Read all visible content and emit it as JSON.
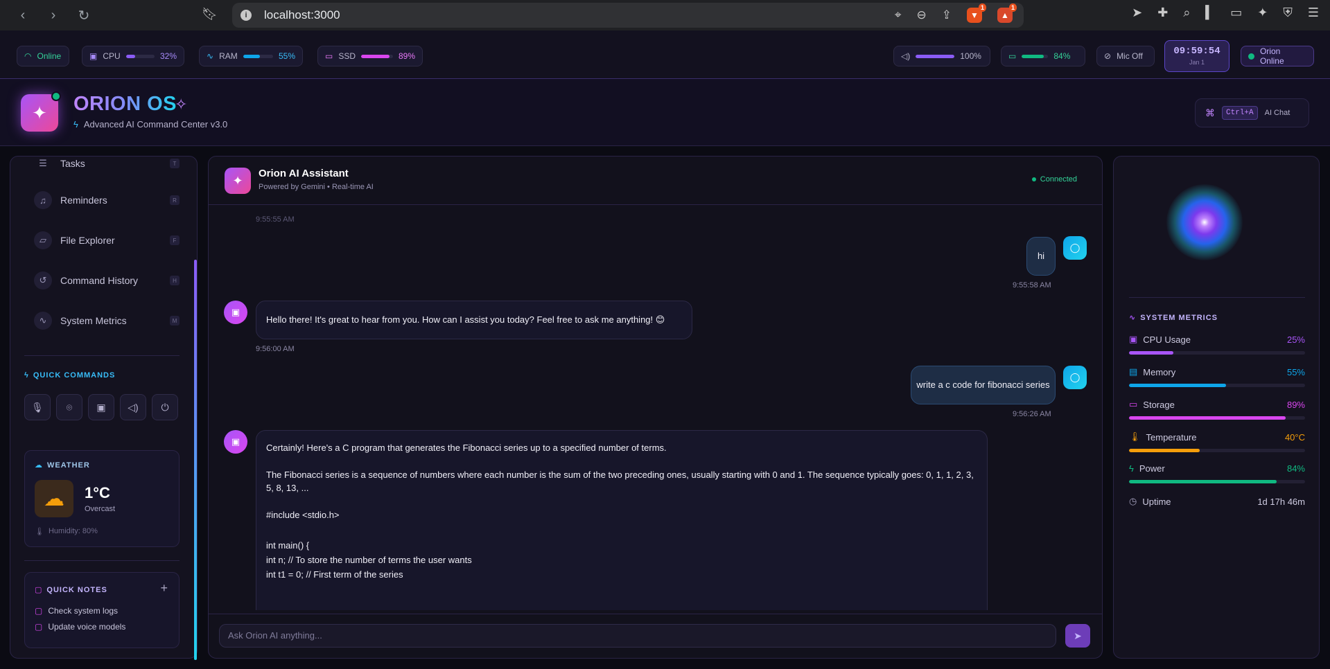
{
  "browser": {
    "url": "localhost:3000",
    "ext_badge_1": "1",
    "ext_badge_2": "1"
  },
  "statusbar": {
    "online": "Online",
    "cpu_label": "CPU",
    "cpu_value": "32%",
    "cpu_level": 0.32,
    "ram_label": "RAM",
    "ram_value": "55%",
    "ram_level": 0.55,
    "ssd_label": "SSD",
    "ssd_value": "89%",
    "ssd_level": 0.89,
    "volume_value": "100%",
    "volume_level": 1.0,
    "battery_value": "84%",
    "battery_level": 0.84,
    "mic": "Mic Off",
    "clock_time": "09:59:54",
    "clock_date": "Jan 1",
    "orion_status": "Orion Online"
  },
  "header": {
    "title": "ORION OS",
    "subtitle": "Advanced AI Command Center v3.0",
    "shortcut_key": "Ctrl+A",
    "shortcut_label": "AI Chat"
  },
  "sidebar": {
    "items": [
      {
        "label": "Tasks",
        "key": "T",
        "icon": "tasks-icon"
      },
      {
        "label": "Reminders",
        "key": "R",
        "icon": "bell-icon"
      },
      {
        "label": "File Explorer",
        "key": "F",
        "icon": "folder-icon"
      },
      {
        "label": "Command History",
        "key": "H",
        "icon": "history-icon"
      },
      {
        "label": "System Metrics",
        "key": "M",
        "icon": "activity-icon"
      }
    ],
    "quick_commands_title": "QUICK COMMANDS",
    "weather": {
      "title": "WEATHER",
      "temp": "1°C",
      "condition": "Overcast",
      "humidity": "Humidity: 80%"
    },
    "notes": {
      "title": "QUICK NOTES",
      "items": [
        "Check system logs",
        "Update voice models"
      ]
    }
  },
  "chat": {
    "title": "Orion AI Assistant",
    "subtitle": "Powered by Gemini • Real-time AI",
    "status": "Connected",
    "partial_time": "9:55:55 AM",
    "messages": [
      {
        "role": "user",
        "text": "hi",
        "time": "9:55:58 AM"
      },
      {
        "role": "bot",
        "text": "Hello there! It's great to hear from you. How can I assist you today? Feel free to ask me anything! 😊",
        "time": "9:56:00 AM"
      },
      {
        "role": "user",
        "text": "write a c code for fibonacci series",
        "time": "9:56:26 AM"
      }
    ],
    "long_reply": {
      "p1": "Certainly! Here's a C program that generates the Fibonacci series up to a specified number of terms.",
      "p2": "The Fibonacci series is a sequence of numbers where each number is the sum of the two preceding ones, usually starting with 0 and 1. The sequence typically goes: 0, 1, 1, 2, 3, 5, 8, 13, ...",
      "code1": "#include <stdio.h>",
      "code2": "int main() {",
      "code3": "int n; // To store the number of terms the user wants",
      "code4": "int t1 = 0; // First term of the series"
    },
    "input_placeholder": "Ask Orion AI anything..."
  },
  "metrics": {
    "title": "SYSTEM METRICS",
    "cpu_label": "CPU Usage",
    "cpu_value": "25%",
    "cpu_level": 0.25,
    "cpu_color": "#a855f7",
    "mem_label": "Memory",
    "mem_value": "55%",
    "mem_level": 0.55,
    "mem_color": "#0ea5e9",
    "sto_label": "Storage",
    "sto_value": "89%",
    "sto_level": 0.89,
    "sto_color": "#d946ef",
    "temp_label": "Temperature",
    "temp_value": "40°C",
    "temp_level": 0.4,
    "temp_color": "#f59e0b",
    "pow_label": "Power",
    "pow_value": "84%",
    "pow_level": 0.84,
    "pow_color": "#10b981",
    "up_label": "Uptime",
    "up_value": "1d 17h 46m"
  }
}
